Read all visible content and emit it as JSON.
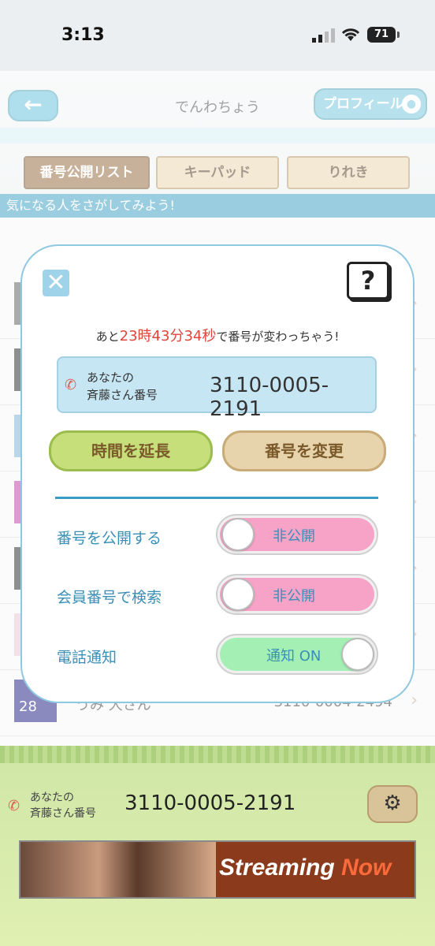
{
  "status_bar": {
    "time": "3:13",
    "battery": "71"
  },
  "header": {
    "title": "でんわちょう",
    "back_label": "←",
    "profile_label": "プロフィール",
    "tabs": [
      "番号公開リスト",
      "キーパッド",
      "りれき"
    ]
  },
  "banner": "気になる人をさがしてみよう!",
  "list": {
    "rows": [
      {
        "name": "",
        "number": ""
      },
      {
        "name": "",
        "number": ""
      },
      {
        "name": "",
        "number": ""
      },
      {
        "name": "",
        "number": ""
      },
      {
        "name": "",
        "number": ""
      },
      {
        "name": "",
        "number": ""
      },
      {
        "name": "うみ 大さん",
        "number": "3110-0004-2494"
      }
    ],
    "thumb_text": "28"
  },
  "modal": {
    "countdown": {
      "prefix": "あと",
      "hours": "23",
      "hours_unit": "時",
      "minutes": "43",
      "minutes_unit": "分",
      "seconds": "34",
      "seconds_unit": "秒",
      "suffix": "で番号が変わっちゃう!"
    },
    "number_label_line1": "あなたの",
    "number_label_line2": "斉藤さん番号",
    "number": "3110-0005-2191",
    "extend_button": "時間を延長",
    "change_button": "番号を変更",
    "help_label": "?",
    "close_label": "✕",
    "settings": [
      {
        "label": "番号を公開する",
        "toggle_text": "非公開",
        "state": "off"
      },
      {
        "label": "会員番号で検索",
        "toggle_text": "非公開",
        "state": "off"
      },
      {
        "label": "電話通知",
        "toggle_text": "通知 ON",
        "state": "on"
      }
    ]
  },
  "footer": {
    "label_line1": "あなたの",
    "label_line2": "斉藤さん番号",
    "number": "3110-0005-2191",
    "ad": {
      "text1": "Streaming",
      "text2": "Now"
    }
  }
}
